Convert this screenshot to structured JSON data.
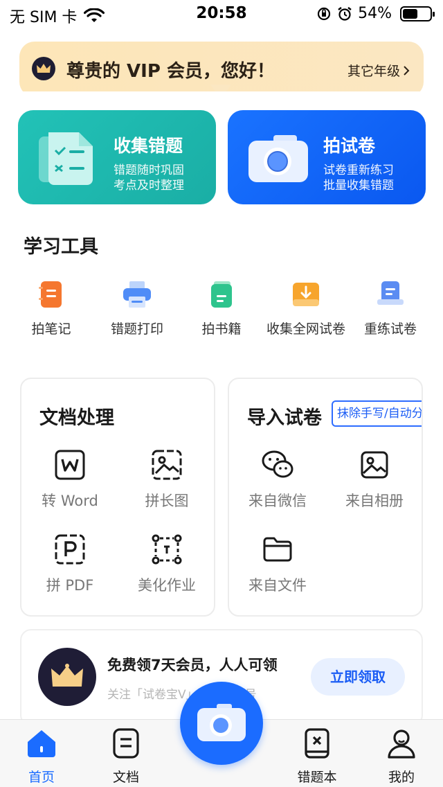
{
  "status_bar": {
    "carrier": "无 SIM 卡",
    "time": "20:58",
    "battery": "54%",
    "battery_level": 0.54
  },
  "vip_banner": {
    "title": "尊贵的 VIP 会员，您好！",
    "other_grade": "其它年级"
  },
  "cards": {
    "collect": {
      "title": "收集错题",
      "line1": "错题随时巩固",
      "line2": "考点及时整理"
    },
    "shoot": {
      "title": "拍试卷",
      "line1": "试卷重新练习",
      "line2": "批量收集错题"
    }
  },
  "study_tools": {
    "title": "学习工具",
    "items": [
      {
        "label": "拍笔记",
        "icon": "notebook-icon",
        "color": "#f5772f"
      },
      {
        "label": "错题打印",
        "icon": "printer-icon",
        "color": "#4f8cf7"
      },
      {
        "label": "拍书籍",
        "icon": "book-icon",
        "color": "#2ec48d"
      },
      {
        "label": "收集全网试卷",
        "icon": "download-tray-icon",
        "color": "#f7a52d"
      },
      {
        "label": "重练试卷",
        "icon": "redo-paper-icon",
        "color": "#5b8cf2"
      }
    ]
  },
  "doc_panel": {
    "title": "文档处理",
    "items": [
      {
        "label": "转 Word",
        "icon": "word-icon"
      },
      {
        "label": "拼长图",
        "icon": "long-image-icon"
      },
      {
        "label": "拼 PDF",
        "icon": "pdf-icon"
      },
      {
        "label": "美化作业",
        "icon": "beautify-icon"
      }
    ]
  },
  "import_panel": {
    "title": "导入试卷",
    "badge": "抹除手写/自动分",
    "items": [
      {
        "label": "来自微信",
        "icon": "wechat-icon"
      },
      {
        "label": "来自相册",
        "icon": "album-icon"
      },
      {
        "label": "来自文件",
        "icon": "folder-icon"
      }
    ]
  },
  "promo": {
    "title": "免费领7天会员，人人可领",
    "subtitle": "关注「试卷宝V」微信公众号",
    "button": "立即领取"
  },
  "tabbar": {
    "tabs": [
      {
        "label": "首页",
        "icon": "home-icon",
        "active": true
      },
      {
        "label": "文档",
        "icon": "document-icon",
        "active": false
      },
      {
        "label": "错题本",
        "icon": "mistake-book-icon",
        "active": false
      },
      {
        "label": "我的",
        "icon": "profile-icon",
        "active": false
      }
    ],
    "camera_icon": "camera-icon"
  },
  "colors": {
    "primary": "#1b6cff",
    "teal": "#22c2b7",
    "vip_gold": "#fde6b8"
  }
}
